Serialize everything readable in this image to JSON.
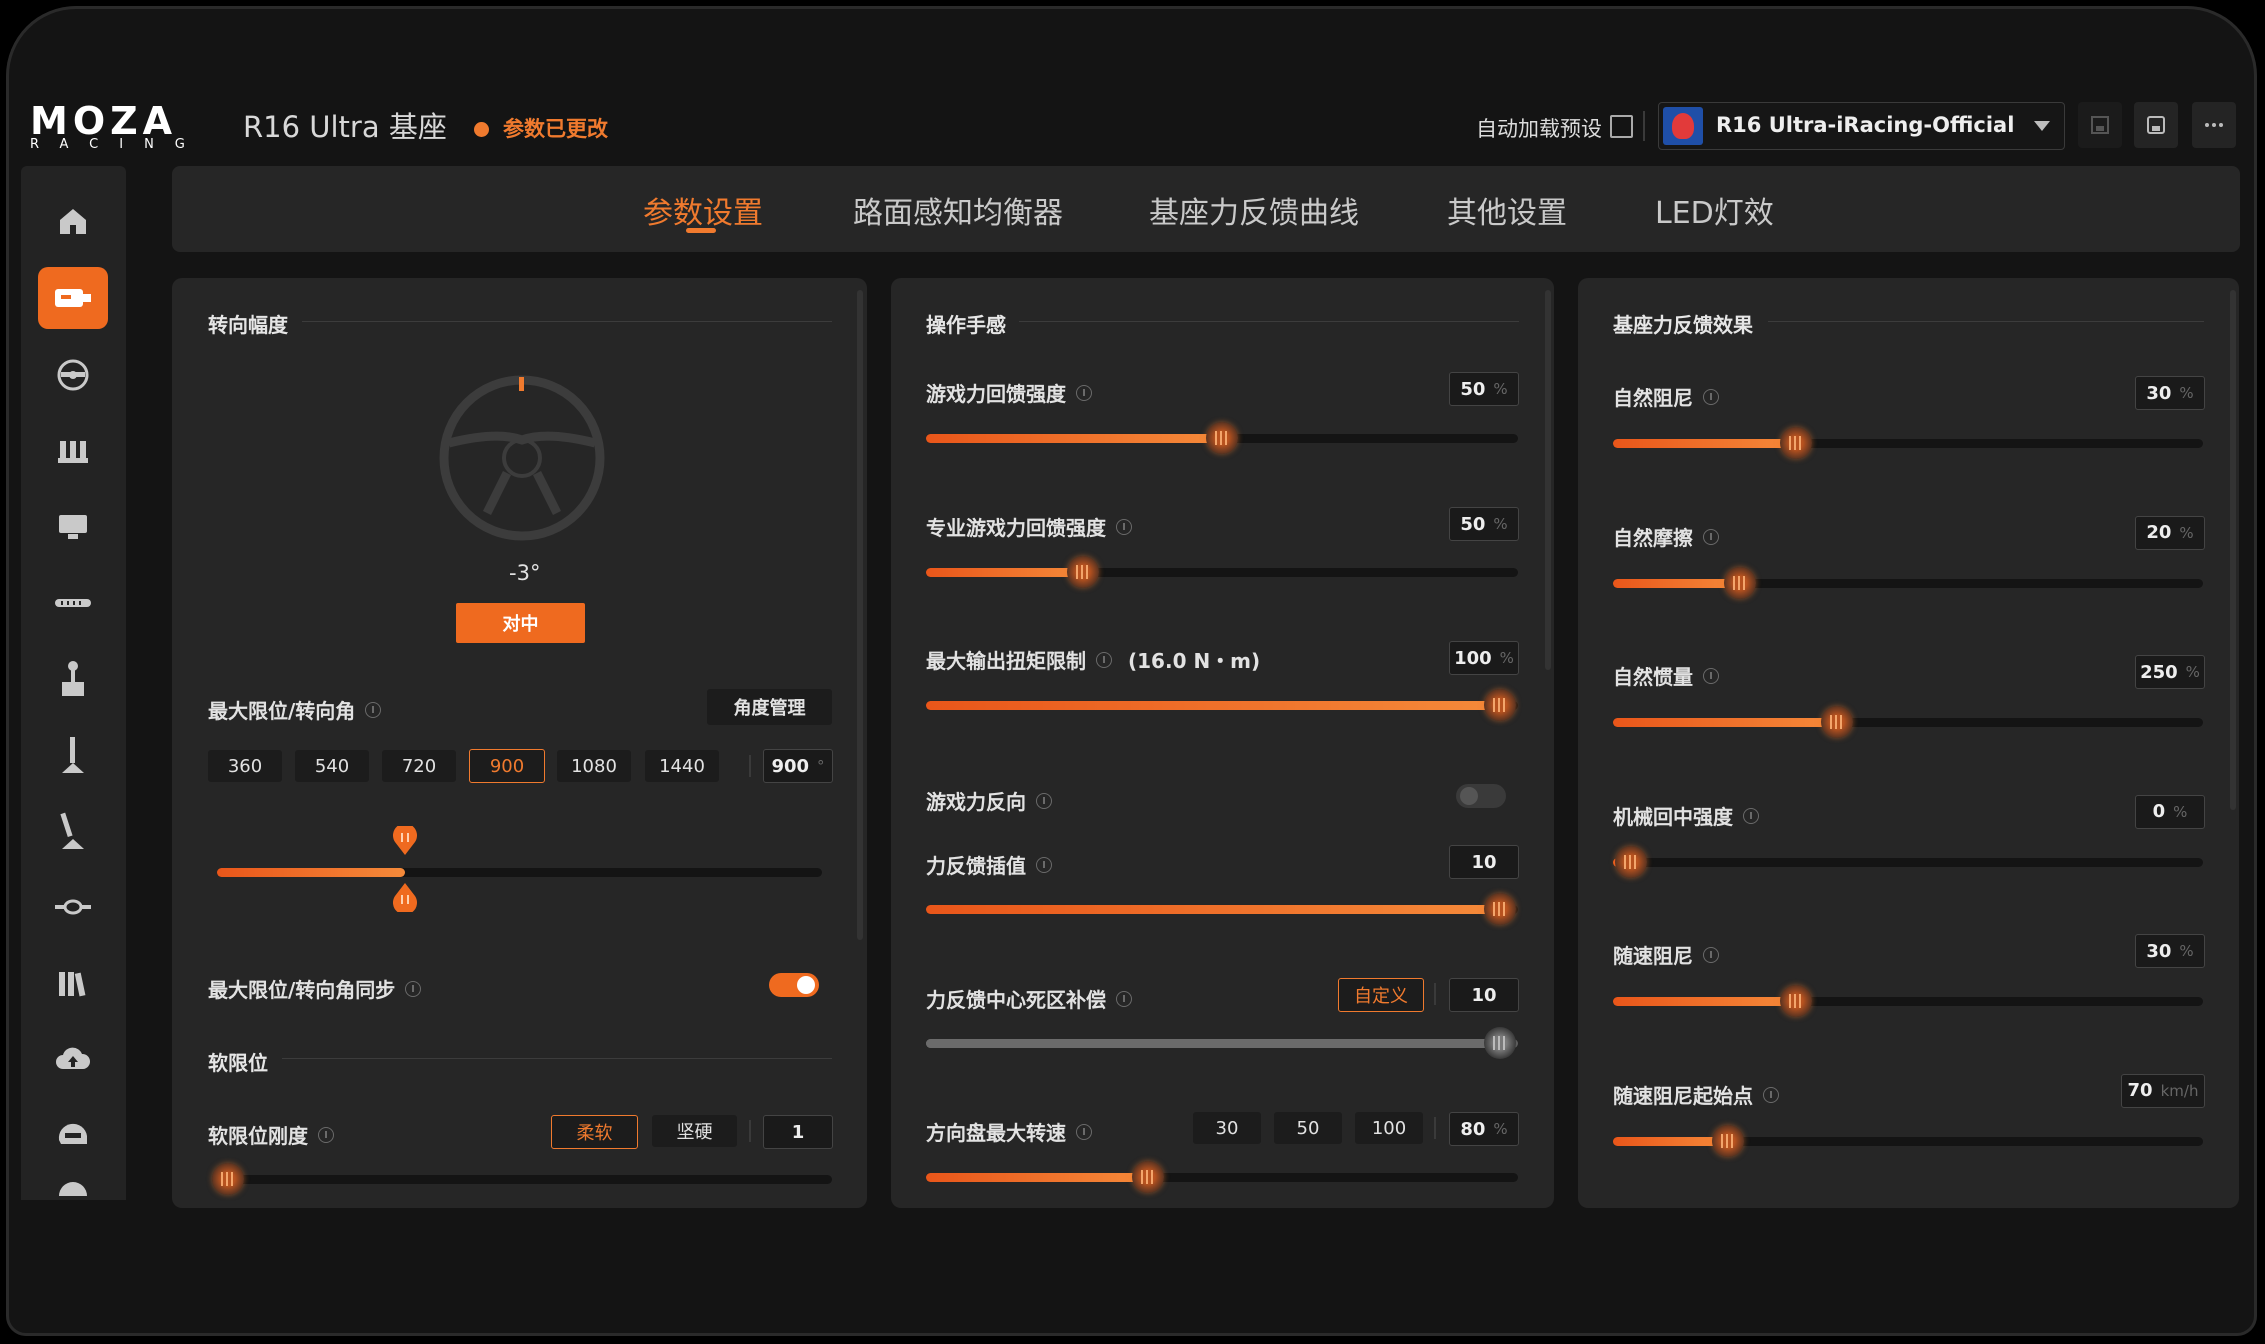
{
  "header": {
    "logo_main": "MOZA",
    "logo_sub": "RACING",
    "device_title": "R16 Ultra 基座",
    "changed_status": "参数已更改",
    "autoload_label": "自动加载预设",
    "preset_name": "R16 Ultra-iRacing-Official"
  },
  "tabs": [
    {
      "label": "参数设置",
      "active": true
    },
    {
      "label": "路面感知均衡器",
      "active": false
    },
    {
      "label": "基座力反馈曲线",
      "active": false
    },
    {
      "label": "其他设置",
      "active": false
    },
    {
      "label": "LED灯效",
      "active": false
    }
  ],
  "sidebar": {
    "items": [
      "home-icon",
      "wheelbase-icon",
      "steering-wheel-icon",
      "pedals-icon",
      "dashboard-icon",
      "handbrake-icon",
      "shifter-icon",
      "sequential-shifter-icon",
      "stick-icon",
      "hub-icon",
      "library-icon",
      "cloud-icon",
      "helmet-icon",
      "more-icon"
    ],
    "active_index": 1
  },
  "left": {
    "section_title": "转向幅度",
    "wheel_angle": "-3°",
    "center_button": "对中",
    "max_limit_label": "最大限位/转向角",
    "angle_manage_button": "角度管理",
    "angle_presets": [
      "360",
      "540",
      "720",
      "900",
      "1080",
      "1440"
    ],
    "angle_selected": "900",
    "angle_value": "900",
    "angle_unit": "°",
    "angle_fraction": 0.31,
    "sync_label": "最大限位/转向角同步",
    "sync_on": true,
    "soft_limit_title": "软限位",
    "soft_stiffness_label": "软限位刚度",
    "soft_btn": "柔软",
    "hard_btn": "坚硬",
    "soft_value": "1",
    "soft_fraction": 0.0
  },
  "middle": {
    "section_title": "操作手感",
    "ffb_strength": {
      "label": "游戏力回馈强度",
      "value": "50",
      "unit": "%",
      "fraction": 0.5
    },
    "pro_ffb_strength": {
      "label": "专业游戏力回馈强度",
      "value": "50",
      "unit": "%",
      "fraction": 0.265
    },
    "max_torque": {
      "label": "最大输出扭矩限制",
      "extra": "(16.0 N・m)",
      "value": "100",
      "unit": "%",
      "fraction": 0.97
    },
    "ffb_reverse": {
      "label": "游戏力反向",
      "on": false
    },
    "ffb_interp": {
      "label": "力反馈插值",
      "value": "10",
      "fraction": 0.97
    },
    "deadzone": {
      "label": "力反馈中心死区补偿",
      "custom_btn": "自定义",
      "value": "10",
      "fraction": 0.97
    },
    "max_speed": {
      "label": "方向盘最大转速",
      "presets": [
        "30",
        "50",
        "100"
      ],
      "value": "80",
      "unit": "%",
      "fraction": 0.375
    }
  },
  "right": {
    "section_title": "基座力反馈效果",
    "items": [
      {
        "label": "自然阻尼",
        "value": "30",
        "unit": "%",
        "fraction": 0.31
      },
      {
        "label": "自然摩擦",
        "value": "20",
        "unit": "%",
        "fraction": 0.215
      },
      {
        "label": "自然惯量",
        "value": "250",
        "unit": "%",
        "fraction": 0.38
      },
      {
        "label": "机械回中强度",
        "value": "0",
        "unit": "%",
        "fraction": 0.03
      },
      {
        "label": "随速阻尼",
        "value": "30",
        "unit": "%",
        "fraction": 0.31
      },
      {
        "label": "随速阻尼起始点",
        "value": "70",
        "unit": "km/h",
        "fraction": 0.195
      }
    ]
  },
  "colors": {
    "accent": "#ef6a1f",
    "panel": "#262626",
    "background": "#141414"
  }
}
